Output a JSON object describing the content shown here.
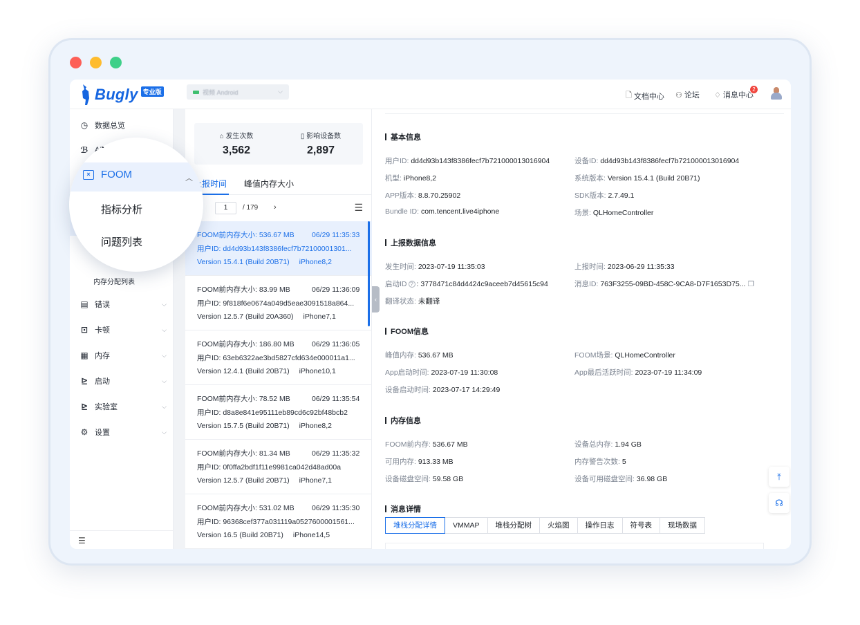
{
  "brand": {
    "name": "Bugly",
    "badge": "专业版",
    "accent": "#1b6fe8"
  },
  "app_selector": {
    "name": "视频 Android"
  },
  "topnav": {
    "docs": "文档中心",
    "forum": "论坛",
    "messages": "消息中心",
    "message_count": "2"
  },
  "sidebar": {
    "items": [
      {
        "label": "数据总览",
        "icon": "clock-icon"
      },
      {
        "label": "ANR",
        "icon": "anr-icon"
      },
      {
        "label": "FOOM",
        "icon": "foom-icon"
      },
      {
        "label": "错误",
        "icon": "error-icon"
      },
      {
        "label": "卡顿",
        "icon": "lag-icon"
      },
      {
        "label": "内存",
        "icon": "memory-icon"
      },
      {
        "label": "启动",
        "icon": "launch-icon"
      },
      {
        "label": "实验室",
        "icon": "lab-icon"
      },
      {
        "label": "设置",
        "icon": "settings-icon"
      }
    ],
    "foom_sub": [
      "指标分析",
      "问题列表"
    ],
    "memory_alloc_list": "内存分配列表",
    "anr_peek": " ANR"
  },
  "stats": {
    "occurrences_label": "发生次数",
    "occurrences_value": "3,562",
    "devices_label": "影响设备数",
    "devices_value": "2,897"
  },
  "list_tabs": [
    "上报时间",
    "峰值内存大小"
  ],
  "pager": {
    "current": "1",
    "total": "/ 179"
  },
  "issues": [
    {
      "mem": "FOOM前内存大小:  536.67 MB",
      "time": "06/29 11:35:33",
      "user": "用户ID:  dd4d93b143f8386fecf7b72100001301...",
      "version": "Version 15.4.1 (Build 20B71)",
      "model": "iPhone8,2"
    },
    {
      "mem": "FOOM前内存大小:  83.99 MB",
      "time": "06/29 11:36:09",
      "user": "用户ID:  9f818f6e0674a049d5eae3091518a864...",
      "version": "Version 12.5.7 (Build 20A360)",
      "model": "iPhone7,1"
    },
    {
      "mem": "FOOM前内存大小:  186.80 MB",
      "time": "06/29 11:36:05",
      "user": "用户ID:  63eb6322ae3bd5827cfd634e000011a1...",
      "version": "Version 12.4.1 (Build 20B71)",
      "model": "iPhone10,1"
    },
    {
      "mem": "FOOM前内存大小:  78.52 MB",
      "time": "06/29 11:35:54",
      "user": "用户ID:  d8a8e841e95111eb89cd6c92bf48bcb2",
      "version": "Version 15.7.5 (Build 20B71)",
      "model": "iPhone8,2"
    },
    {
      "mem": "FOOM前内存大小:  81.34 MB",
      "time": "06/29 11:35:32",
      "user": "用户ID:  0f0ffa2bdf1f11e9981ca042d48ad00a",
      "version": "Version 12.5.7 (Build 20B71)",
      "model": "iPhone7,1"
    },
    {
      "mem": "FOOM前内存大小:  531.02 MB",
      "time": "06/29 11:35:30",
      "user": "用户ID:  96368cef377a031119a0527600001561...",
      "version": "Version 16.5 (Build 20B71)",
      "model": "iPhone14,5"
    }
  ],
  "detail": {
    "basic": {
      "title": "基本信息",
      "user_id_k": "用户ID: ",
      "user_id_v": "dd4d93b143f8386fecf7b721000013016904",
      "device_id_k": "设备ID: ",
      "device_id_v": "dd4d93b143f8386fecf7b721000013016904",
      "model_k": "机型: ",
      "model_v": "iPhone8,2",
      "os_k": "系统版本: ",
      "os_v": "Version 15.4.1 (Build 20B71)",
      "app_k": "APP版本: ",
      "app_v": "8.8.70.25902",
      "sdk_k": "SDK版本: ",
      "sdk_v": "2.7.49.1",
      "bundle_k": "Bundle ID: ",
      "bundle_v": "com.tencent.live4iphone",
      "scene_k": "场景: ",
      "scene_v": "QLHomeController"
    },
    "report": {
      "title": "上报数据信息",
      "occur_k": "发生时间: ",
      "occur_v": "2023-07-19 11:35:03",
      "report_k": "上报时间: ",
      "report_v": "2023-06-29 11:35:33",
      "launch_k": "启动ID",
      "launch_v": ":  3778471c84d4424c9aceeb7d45615c94",
      "msg_k": "消息ID: ",
      "msg_v": "763F3255-09BD-458C-9CA8-D7F1653D75...",
      "trans_k": "翻译状态: ",
      "trans_v": "未翻译"
    },
    "foom": {
      "title": "FOOM信息",
      "peak_k": "峰值内存: ",
      "peak_v": "536.67 MB",
      "scene_k": "FOOM场景: ",
      "scene_v": "QLHomeController",
      "applaunch_k": "App启动时间: ",
      "applaunch_v": "2023-07-19 11:30:08",
      "lastactive_k": "App最后活跃时间: ",
      "lastactive_v": "2023-07-19 11:34:09",
      "devlaunch_k": "设备启动时间: ",
      "devlaunch_v": "2023-07-17 14:29:49"
    },
    "memory": {
      "title": "内存信息",
      "pre_k": "FOOM前内存: ",
      "pre_v": "536.67 MB",
      "total_k": "设备总内存: ",
      "total_v": "1.94 GB",
      "avail_k": "可用内存: ",
      "avail_v": "913.33 MB",
      "warn_k": "内存警告次数: ",
      "warn_v": "5",
      "disk_k": "设备磁盘空间: ",
      "disk_v": "59.58 GB",
      "diskfree_k": "设备可用磁盘空间: ",
      "diskfree_v": "36.98 GB"
    },
    "message": {
      "title": "消息详情",
      "tabs": [
        "堆栈分配详情",
        "VMMAP",
        "堆栈分配树",
        "火焰图",
        "操作日志",
        "符号表",
        "现场数据"
      ]
    }
  }
}
